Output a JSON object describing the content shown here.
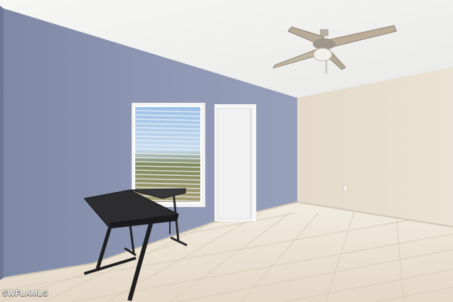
{
  "image": {
    "watermark_text": "SWFLAMLS",
    "palette": {
      "ceiling": "#f1f1f0",
      "accent_wall": "#8a94b0",
      "side_wall": "#e6dccb",
      "floor_tile": "#ebe2d3",
      "door": "#f4f4f4",
      "desk": "#2b2b2e"
    },
    "icons": [
      "ceiling-fan-icon"
    ]
  }
}
